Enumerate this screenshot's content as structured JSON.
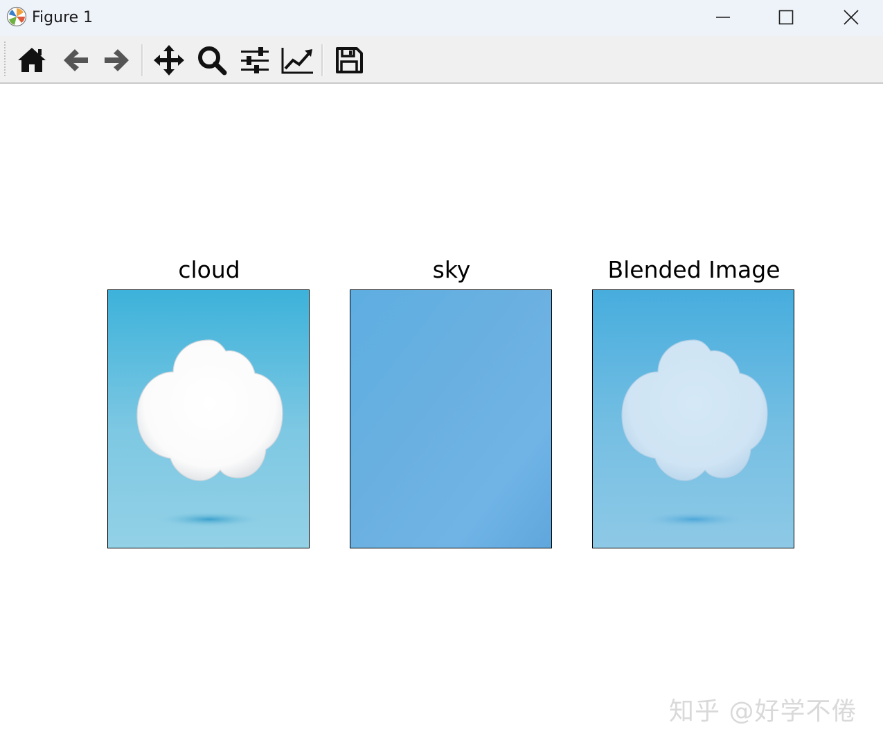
{
  "window": {
    "title": "Figure 1",
    "app_icon": "matplotlib-logo-icon",
    "controls": [
      "minimize-icon",
      "maximize-icon",
      "close-icon"
    ]
  },
  "toolbar": {
    "tools": [
      {
        "name": "home",
        "icon": "home-icon"
      },
      {
        "name": "back",
        "icon": "arrow-left-icon"
      },
      {
        "name": "forward",
        "icon": "arrow-right-icon"
      },
      {
        "name": "pan",
        "icon": "move-icon"
      },
      {
        "name": "zoom",
        "icon": "zoom-icon"
      },
      {
        "name": "configure-subplots",
        "icon": "sliders-icon"
      },
      {
        "name": "edit-axes",
        "icon": "line-chart-icon"
      },
      {
        "name": "save",
        "icon": "floppy-disk-icon"
      }
    ]
  },
  "figure": {
    "panels": [
      {
        "title": "cloud",
        "content": "cloud-image"
      },
      {
        "title": "sky",
        "content": "sky-image"
      },
      {
        "title": "Blended Image",
        "content": "blended-image"
      }
    ]
  },
  "watermark": "知乎 @好学不倦",
  "colors": {
    "titlebar_bg": "#eef2f9",
    "toolbar_bg": "#f0f0f0",
    "sky_top": "#3db2da",
    "sky_bottom": "#93d1e6",
    "sky_panel": "#66ade0",
    "blend_top": "#47addd",
    "blend_bottom": "#8ec9e6"
  }
}
